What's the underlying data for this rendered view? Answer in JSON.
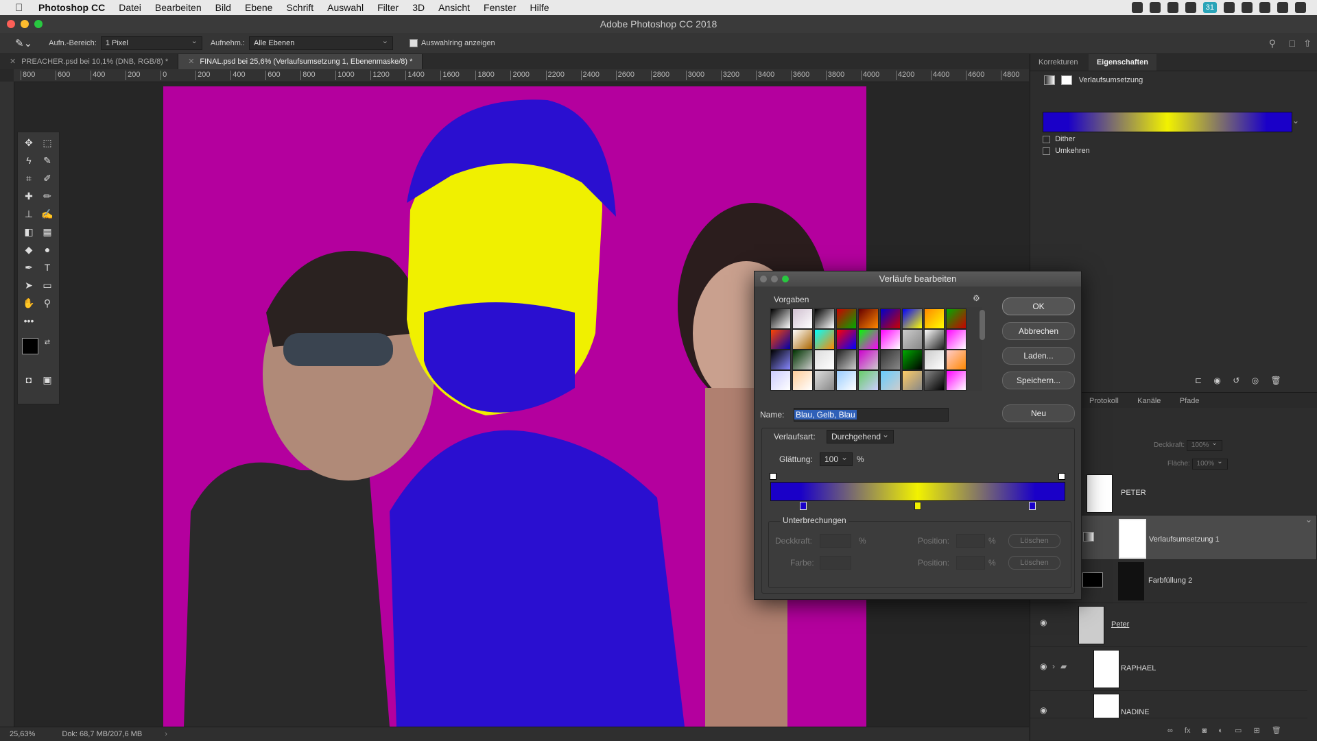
{
  "menubar": {
    "apple": "",
    "items": [
      "Photoshop CC",
      "Datei",
      "Bearbeiten",
      "Bild",
      "Ebene",
      "Schrift",
      "Auswahl",
      "Filter",
      "3D",
      "Ansicht",
      "Fenster",
      "Hilfe"
    ],
    "battery_badge": "31"
  },
  "window": {
    "title": "Adobe Photoshop CC 2018"
  },
  "options": {
    "sample_size_label": "Aufn.-Bereich:",
    "sample_size_value": "1 Pixel",
    "sample_label": "Aufnehm.:",
    "sample_value": "Alle Ebenen",
    "show_ring_label": "Auswahlring anzeigen"
  },
  "tabs": [
    {
      "label": "PREACHER.psd bei 10,1% (DNB, RGB/8) *"
    },
    {
      "label": "FINAL.psd bei 25,6% (Verlaufsumsetzung 1, Ebenenmaske/8) *"
    }
  ],
  "ruler": {
    "ticks": [
      "800",
      "600",
      "400",
      "200",
      "0",
      "200",
      "400",
      "600",
      "800",
      "1000",
      "1200",
      "1400",
      "1600",
      "1800",
      "2000",
      "2200",
      "2400",
      "2600",
      "2800",
      "3000",
      "3200",
      "3400",
      "3600",
      "3800",
      "4000",
      "4200",
      "4400",
      "4600",
      "4800"
    ]
  },
  "status": {
    "zoom": "25,63%",
    "doc": "Dok: 68,7 MB/207,6 MB"
  },
  "properties": {
    "tab_corrections": "Korrekturen",
    "tab_properties": "Eigenschaften",
    "adjustment_name": "Verlaufsumsetzung",
    "dither_label": "Dither",
    "reverse_label": "Umkehren"
  },
  "layers_panel": {
    "tab_history": "Protokoll",
    "tab_channels": "Kanäle",
    "tab_paths": "Pfade",
    "opacity_label": "Deckkraft:",
    "opacity_value": "100%",
    "fill_label": "Fläche:",
    "fill_value": "100%",
    "layers": [
      {
        "name": "PETER"
      },
      {
        "name": "Verlaufsumsetzung 1"
      },
      {
        "name": "Farbfüllung 2"
      },
      {
        "name": "Peter"
      },
      {
        "name": "RAPHAEL"
      },
      {
        "name": "NADINE"
      }
    ]
  },
  "dialog": {
    "title": "Verläufe bearbeiten",
    "presets_label": "Vorgaben",
    "ok": "OK",
    "cancel": "Abbrechen",
    "load": "Laden...",
    "save": "Speichern...",
    "new": "Neu",
    "name_label": "Name:",
    "name_value": "Blau, Gelb, Blau",
    "type_label": "Verlaufsart:",
    "type_value": "Durchgehend",
    "smooth_label": "Glättung:",
    "smooth_value": "100",
    "percent": "%",
    "stops_label": "Unterbrechungen",
    "opacity_label": "Deckkraft:",
    "position_label": "Position:",
    "delete_label": "Löschen",
    "color_label": "Farbe:",
    "gradient_colors": [
      "#1a00c8",
      "#f2f200",
      "#1a00c8"
    ]
  },
  "colors": {
    "canvas_bg": "#b4009e",
    "blue": "#2a0fd0",
    "yellow": "#f0f000"
  }
}
